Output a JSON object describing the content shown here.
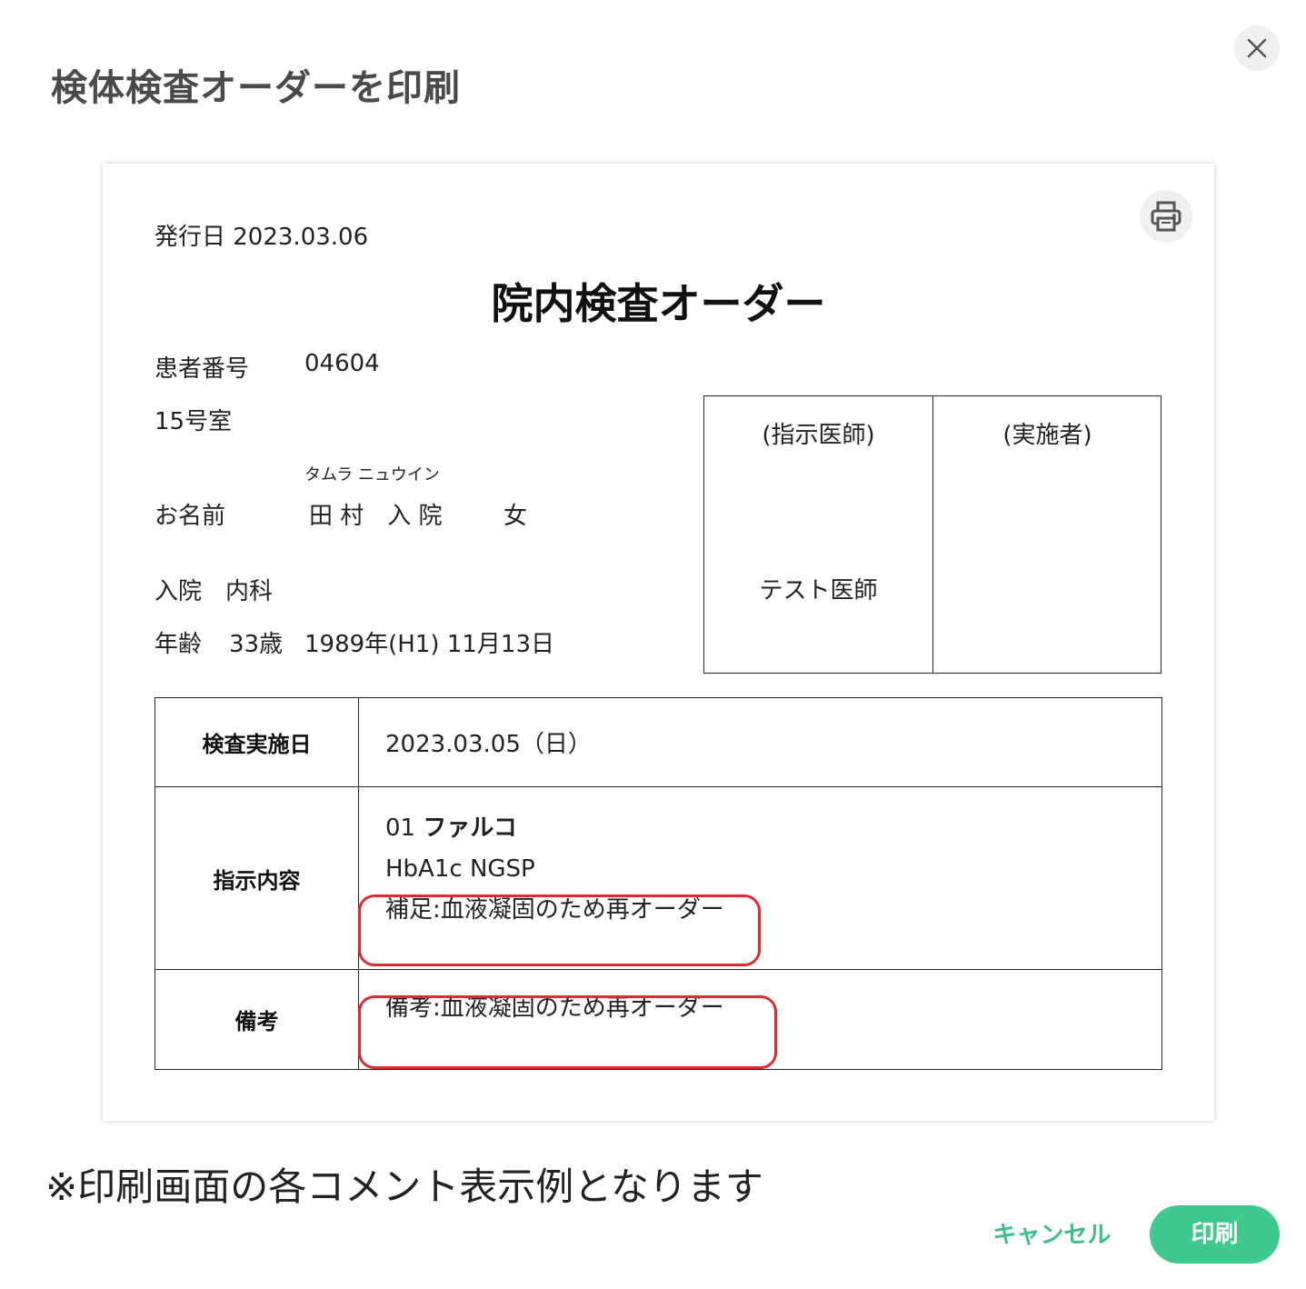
{
  "dialog": {
    "title": "検体検査オーダーを印刷",
    "close_icon": "close-icon"
  },
  "sheet": {
    "print_icon": "printer-icon",
    "issue_date": "発行日 2023.03.06",
    "doc_title": "院内検査オーダー",
    "patient_id_label": "患者番号",
    "patient_id": "04604",
    "room": "15号室",
    "name_kana": "タムラ ニュウイン",
    "name_label": "お名前",
    "name": "田 村　入 院",
    "sex": "女",
    "ward": "入院　内科",
    "age_label": "年齢",
    "age": "33歳",
    "birth": "1989年(H1) 11月13日",
    "sign_doctor_label": "(指示医師)",
    "sign_doctor_name": "テスト医師",
    "sign_executor_label": "(実施者)"
  },
  "table": {
    "date_header": "検査実施日",
    "date_value": "2023.03.05（日）",
    "order_header": "指示内容",
    "order_no": "01",
    "order_name": "ファルコ",
    "order_item": "HbA1c NGSP",
    "order_supplement": "補足:血液凝固のため再オーダー",
    "remarks_header": "備考",
    "remarks_value": "備考:血液凝固のため再オーダー"
  },
  "annotation": {
    "note": "※印刷画面の各コメント表示例となります",
    "highlight_color": "#e02a32"
  },
  "footer": {
    "cancel_label": "キャンセル",
    "print_label": "印刷",
    "accent_color": "#3fc98f"
  }
}
